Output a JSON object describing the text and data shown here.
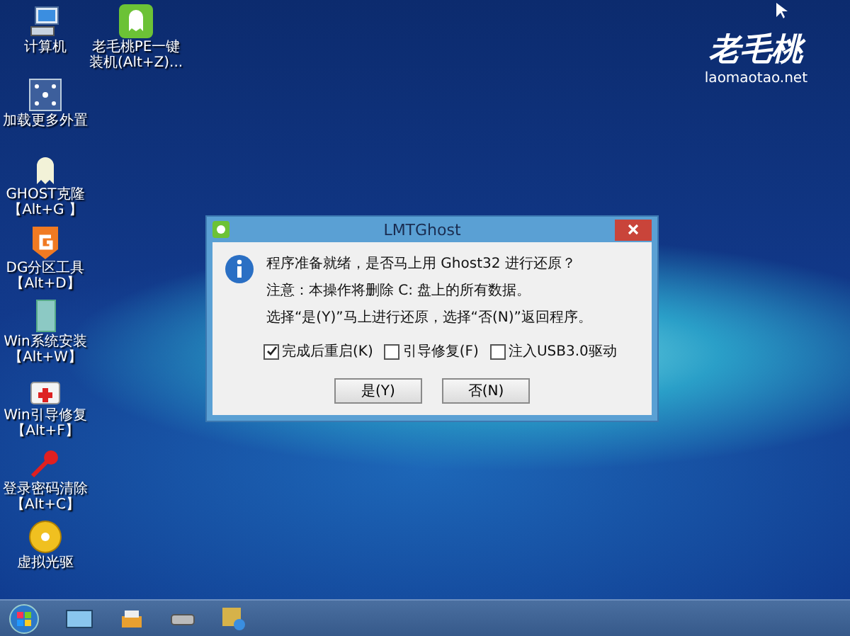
{
  "desktop_icons": [
    {
      "kind": "computer",
      "lines": [
        "计算机"
      ]
    },
    {
      "kind": "devices",
      "lines": [
        "加载更多外置"
      ]
    },
    {
      "kind": "ghost",
      "lines": [
        "GHOST克隆",
        "【Alt+G 】"
      ]
    },
    {
      "kind": "partition",
      "lines": [
        "DG分区工具",
        "【Alt+D】"
      ]
    },
    {
      "kind": "install",
      "lines": [
        "Win系统安装",
        "【Alt+W】"
      ]
    },
    {
      "kind": "repair",
      "lines": [
        "Win引导修复",
        "【Alt+F】"
      ]
    },
    {
      "kind": "password",
      "lines": [
        "登录密码清除",
        "【Alt+C】"
      ]
    },
    {
      "kind": "disc",
      "lines": [
        "虚拟光驱"
      ]
    }
  ],
  "desktop_icons_column_2": [
    {
      "kind": "pe",
      "lines": [
        "老毛桃PE一键",
        "装机(Alt+Z)..."
      ]
    }
  ],
  "logo": {
    "name": "老毛桃",
    "url": "laomaotao.net"
  },
  "dialog": {
    "title": "LMTGhost",
    "message": [
      "程序准备就绪，是否马上用 Ghost32 进行还原？",
      "注意：本操作将删除 C: 盘上的所有数据。",
      "选择“是(Y)”马上进行还原，选择“否(N)”返回程序。"
    ],
    "options": [
      {
        "label": "完成后重启(K)",
        "checked": true
      },
      {
        "label": "引导修复(F)",
        "checked": false
      },
      {
        "label": "注入USB3.0驱动",
        "checked": false
      }
    ],
    "buttons": [
      "是(Y)",
      "否(N)"
    ]
  }
}
